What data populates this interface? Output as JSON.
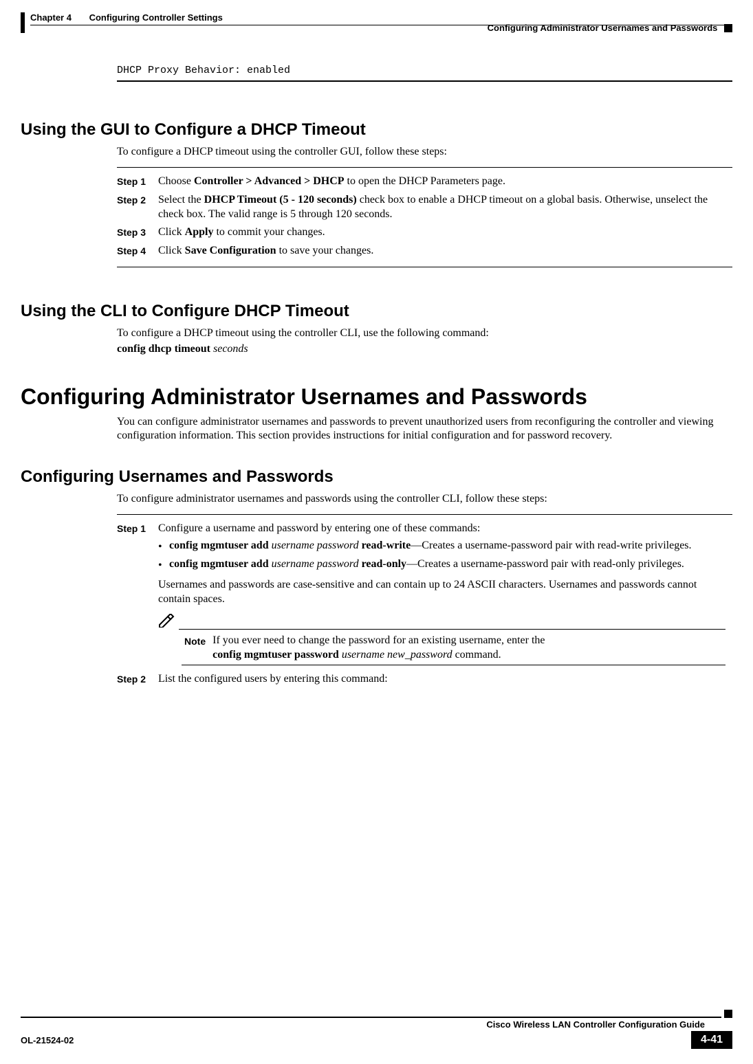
{
  "header": {
    "chapter": "Chapter 4",
    "chapter_title": "Configuring Controller Settings",
    "section": "Configuring Administrator Usernames and Passwords"
  },
  "codeline": "DHCP Proxy Behavior: enabled",
  "h_gui": "Using the GUI to Configure a DHCP Timeout",
  "p_gui_intro": "To configure a DHCP timeout using the controller GUI, follow these steps:",
  "steps_gui": [
    {
      "label": "Step 1",
      "b1": "Controller > Advanced > DHCP",
      "pre": "Choose ",
      "post": " to open the DHCP Parameters page."
    },
    {
      "label": "Step 2",
      "b1": "DHCP Timeout (5 - 120 seconds)",
      "pre": "Select the ",
      "post": " check box to enable a DHCP timeout on a global basis. Otherwise, unselect the check box. The valid range is 5 through 120 seconds."
    },
    {
      "label": "Step 3",
      "b1": "Apply",
      "pre": "Click ",
      "post": " to commit your changes."
    },
    {
      "label": "Step 4",
      "b1": "Save Configuration",
      "pre": "Click ",
      "post": " to save your changes."
    }
  ],
  "h_cli": "Using the CLI to Configure DHCP Timeout",
  "p_cli_intro": "To configure a DHCP timeout using the controller CLI, use the following command:",
  "cli_cmd_bold": "config dhcp timeout",
  "cli_cmd_ital": "seconds",
  "h_admin": "Configuring Administrator Usernames and Passwords",
  "p_admin_intro": "You can configure administrator usernames and passwords to prevent unauthorized users from reconfiguring the controller and viewing configuration information. This section provides instructions for initial configuration and for password recovery.",
  "h_conf": "Configuring Usernames and Passwords",
  "p_conf_intro": "To configure administrator usernames and passwords using the controller CLI, follow these steps:",
  "steps_conf": {
    "s1": {
      "label": "Step 1",
      "intro": "Configure a username and password by entering one of these commands:",
      "b1_b": "config mgmtuser add",
      "b1_i": "username password",
      "b1_b2": "read-write",
      "b1_post": "—Creates a username-password pair with read-write privileges.",
      "b2_b": "config mgmtuser add",
      "b2_i": "username password",
      "b2_b2": "read-only",
      "b2_post": "—Creates a username-password pair with read-only privileges.",
      "after": "Usernames and passwords are case-sensitive and can contain up to 24 ASCII characters. Usernames and passwords cannot contain spaces.",
      "note_label": "Note",
      "note_pre": "If you ever need to change the password for an existing username, enter the ",
      "note_b": "config mgmtuser password",
      "note_i": "username new_password",
      "note_post": " command."
    },
    "s2": {
      "label": "Step 2",
      "text": "List the configured users by entering this command:"
    }
  },
  "footer": {
    "guide": "Cisco Wireless LAN Controller Configuration Guide",
    "doc": "OL-21524-02",
    "page": "4-41"
  }
}
